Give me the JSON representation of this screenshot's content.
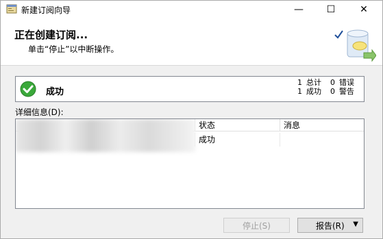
{
  "window": {
    "title": "新建订阅向导",
    "minimize_icon": "—",
    "maximize_icon": "☐",
    "close_icon": "✕"
  },
  "banner": {
    "title": "正在创建订阅...",
    "subtitle": "单击“停止”以中断操作。"
  },
  "status": {
    "label": "成功",
    "stats": [
      {
        "count": "1",
        "label": "总计",
        "count2": "0",
        "label2": "错误"
      },
      {
        "count": "1",
        "label": "成功",
        "count2": "0",
        "label2": "警告"
      }
    ]
  },
  "details": {
    "label": "详细信息(D):",
    "columns": [
      "",
      "状态",
      "消息"
    ],
    "rows": [
      {
        "action": "",
        "status": "成功",
        "message": ""
      }
    ]
  },
  "buttons": {
    "stop": "停止(S)",
    "report": "报告(R)",
    "report_arrow": "▼"
  },
  "colors": {
    "success": "#3aa83a",
    "border": "#828790",
    "button": "#e1e1e1"
  }
}
